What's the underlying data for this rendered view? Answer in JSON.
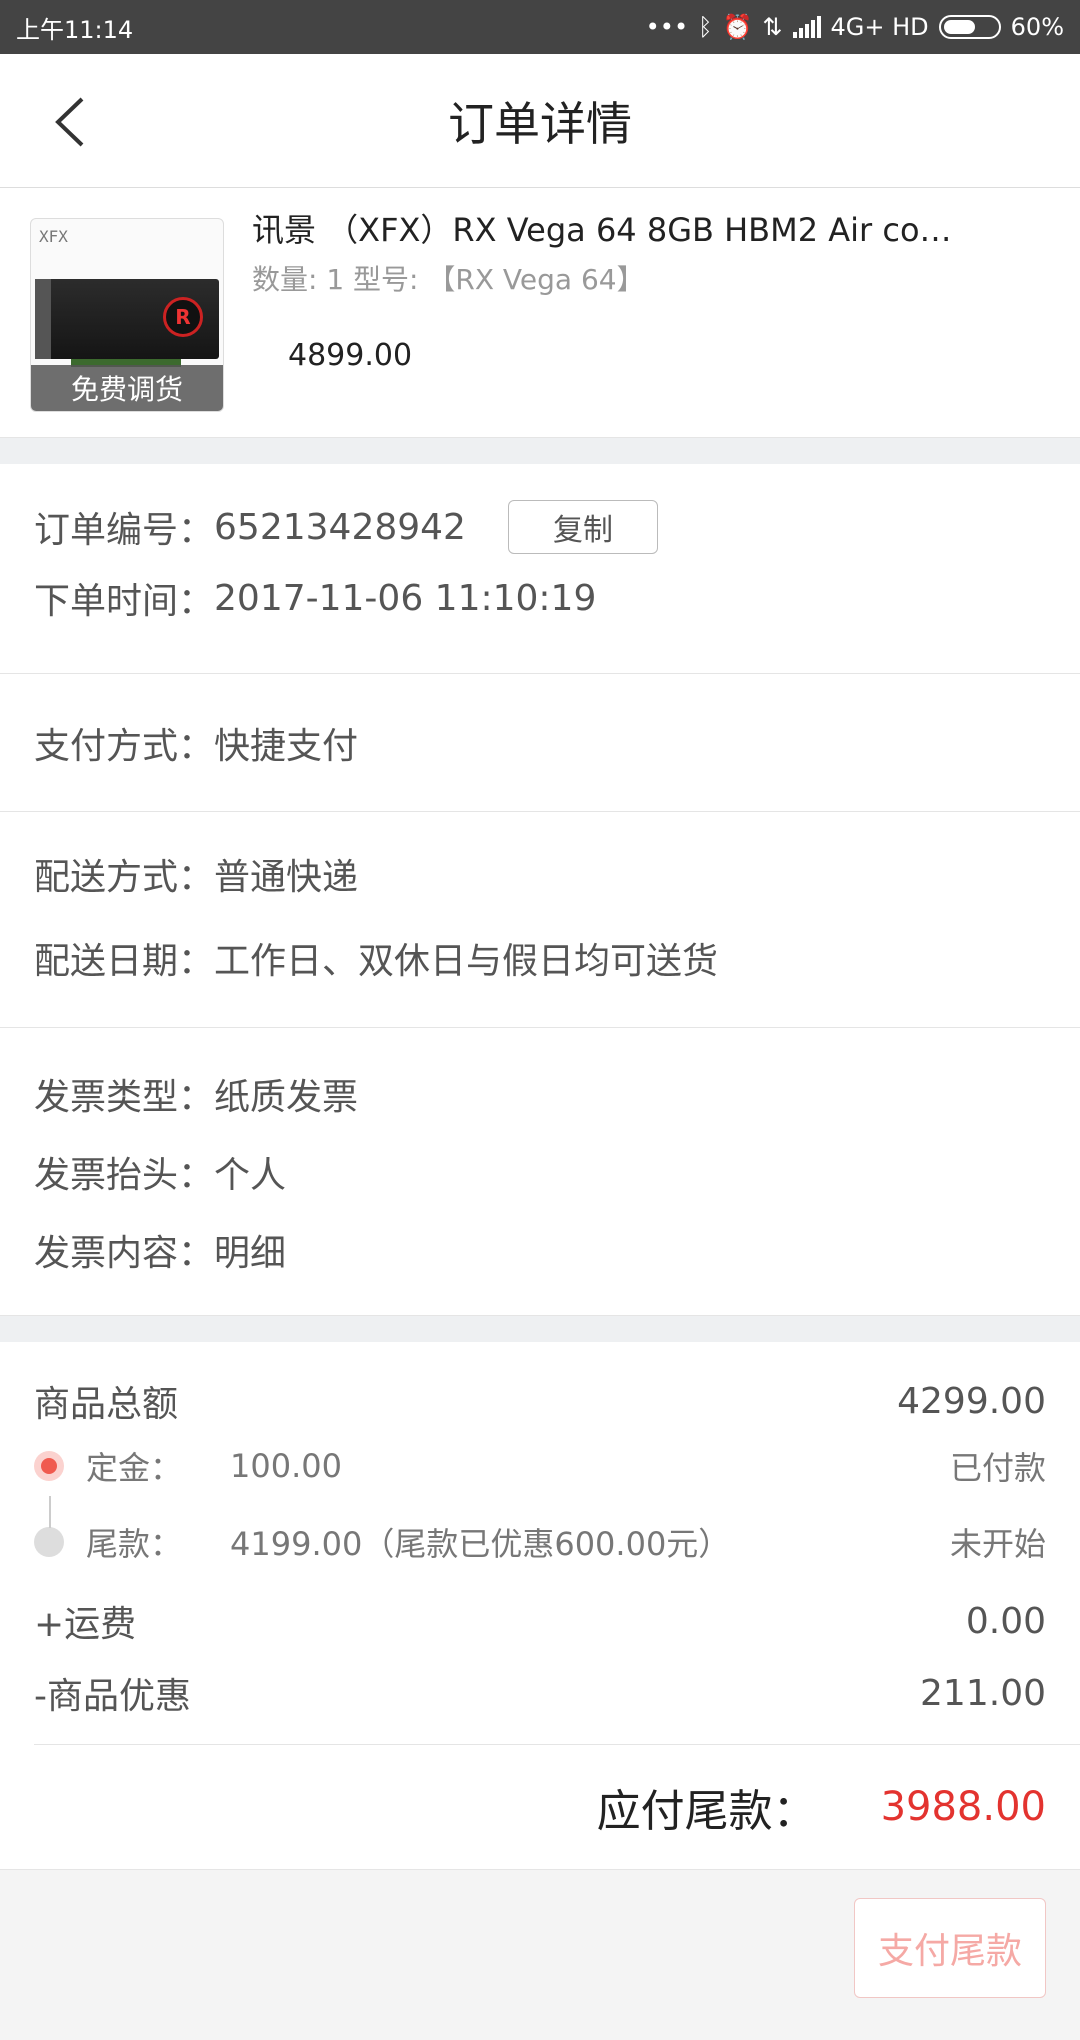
{
  "status_bar": {
    "time": "上午11:14",
    "network": "4G+ HD",
    "battery": "60%",
    "battery_level": 0.6
  },
  "header": {
    "title": "订单详情"
  },
  "product": {
    "thumb_brand": "XFX",
    "badge": "免费调货",
    "name": "讯景 （XFX）RX Vega 64 8GB HBM2 Air co…",
    "spec": "数量: 1 型号: 【RX Vega 64】",
    "price": "4899.00"
  },
  "order_info": {
    "order_no_label": "订单编号：",
    "order_no": "65213428942",
    "copy_label": "复制",
    "time_label": "下单时间：",
    "time": "2017-11-06 11:10:19"
  },
  "payment": {
    "label": "支付方式：",
    "value": "快捷支付"
  },
  "delivery": {
    "method_label": "配送方式：",
    "method": "普通快递",
    "date_label": "配送日期：",
    "date": "工作日、双休日与假日均可送货"
  },
  "invoice": {
    "type_label": "发票类型：",
    "type": "纸质发票",
    "title_label": "发票抬头：",
    "title": "个人",
    "content_label": "发票内容：",
    "content": "明细"
  },
  "summary": {
    "goods_total_label": "商品总额",
    "goods_total": "4299.00",
    "deposit_label": "定金：",
    "deposit": "100.00",
    "deposit_status": "已付款",
    "balance_label": "尾款：",
    "balance": "4199.00（尾款已优惠600.00元）",
    "balance_status": "未开始",
    "shipping_label": "+运费",
    "shipping": "0.00",
    "discount_label": "-商品优惠",
    "discount": "211.00",
    "due_label": "应付尾款：",
    "due": "3988.00"
  },
  "footer": {
    "pay_label": "支付尾款"
  },
  "colors": {
    "accent": "#e3332f",
    "status_bar": "#444444",
    "gap": "#eef0f2"
  }
}
